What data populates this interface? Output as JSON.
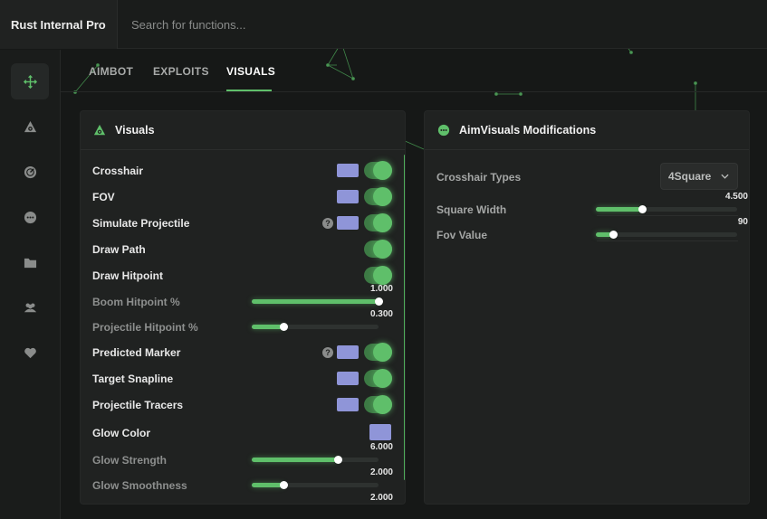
{
  "app": {
    "title": "Rust Internal Pro",
    "search_placeholder": "Search for functions..."
  },
  "sidebar": {
    "items": [
      {
        "name": "aimbot",
        "icon": "crosshair-move-icon",
        "active": true
      },
      {
        "name": "visuals",
        "icon": "eye-triangle-icon"
      },
      {
        "name": "radar",
        "icon": "radar-icon"
      },
      {
        "name": "misc",
        "icon": "chat-dots-icon"
      },
      {
        "name": "configs",
        "icon": "folder-icon"
      },
      {
        "name": "players",
        "icon": "users-icon"
      },
      {
        "name": "favorites",
        "icon": "heart-icon"
      }
    ]
  },
  "tabs": {
    "items": [
      {
        "label": "AIMBOT"
      },
      {
        "label": "EXPLOITS"
      },
      {
        "label": "VISUALS",
        "active": true
      }
    ]
  },
  "visuals_panel": {
    "title": "Visuals",
    "crosshair": {
      "label": "Crosshair",
      "color": "#8f95d8",
      "enabled": true
    },
    "fov": {
      "label": "FOV",
      "color": "#8f95d8",
      "enabled": true
    },
    "simulate_projectile": {
      "label": "Simulate Projectile",
      "help": "?",
      "color": "#8f95d8",
      "enabled": true
    },
    "draw_path": {
      "label": "Draw Path",
      "enabled": true
    },
    "draw_hitpoint": {
      "label": "Draw Hitpoint",
      "enabled": true
    },
    "boom_hitpoint": {
      "label": "Boom Hitpoint %",
      "value": "1.000",
      "fraction": 1.0
    },
    "projectile_hitpoint": {
      "label": "Projectile Hitpoint %",
      "value": "0.300",
      "fraction": 0.25
    },
    "predicted_marker": {
      "label": "Predicted Marker",
      "help": "?",
      "color": "#8f95d8",
      "enabled": true
    },
    "target_snapline": {
      "label": "Target Snapline",
      "color": "#8f95d8",
      "enabled": true
    },
    "projectile_tracers": {
      "label": "Projectile Tracers",
      "color": "#8f95d8",
      "enabled": true
    },
    "glow_color": {
      "label": "Glow Color",
      "color": "#8f95d8"
    },
    "glow_strength": {
      "label": "Glow Strength",
      "value": "6.000",
      "fraction": 0.68
    },
    "glow_smoothness": {
      "label": "Glow Smoothness",
      "value": "2.000",
      "fraction": 0.25
    },
    "next_value": "2.000"
  },
  "aimvisuals_panel": {
    "title": "AimVisuals Modifications",
    "crosshair_types": {
      "label": "Crosshair Types",
      "selected": "4Square"
    },
    "square_width": {
      "label": "Square Width",
      "value": "4.500",
      "fraction": 0.33
    },
    "fov_value": {
      "label": "Fov Value",
      "value": "90",
      "fraction": 0.12
    }
  },
  "colors": {
    "accent": "#5fbf6a",
    "swatch": "#8f95d8",
    "background": "#161817",
    "panel": "#202221"
  }
}
